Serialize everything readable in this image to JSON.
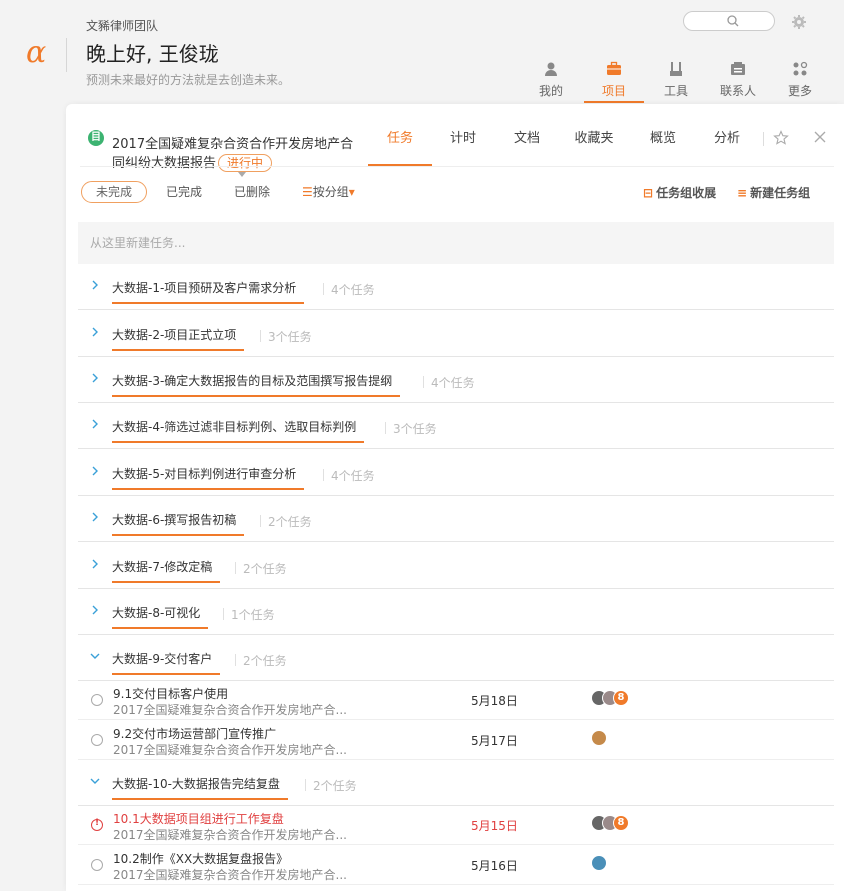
{
  "header": {
    "team": "文豨律师团队",
    "greeting": "晚上好, 王俊珑",
    "motto": "预测未来最好的方法就是去创造未来。"
  },
  "topnav": [
    {
      "label": "我的",
      "icon": "user-icon"
    },
    {
      "label": "项目",
      "icon": "briefcase-icon",
      "active": true
    },
    {
      "label": "工具",
      "icon": "tools-icon"
    },
    {
      "label": "联系人",
      "icon": "contacts-icon"
    },
    {
      "label": "更多",
      "icon": "grid-icon"
    }
  ],
  "project": {
    "icon_letter": "目",
    "title_line1": "2017全国疑难复杂合资合作开发房地产合",
    "title_line2": "同纠纷大数据报告",
    "status": "进行中",
    "tabs": [
      "任务",
      "计时",
      "文档",
      "收藏夹",
      "概览",
      "分析"
    ]
  },
  "filters": {
    "incomplete": "未完成",
    "completed": "已完成",
    "deleted": "已删除",
    "group_by": "按分组",
    "collapse_groups": "任务组收展",
    "new_group": "新建任务组"
  },
  "new_task_placeholder": "从这里新建任务...",
  "groups": [
    {
      "name": "大数据-1-项目预研及客户需求分析",
      "count": "4个任务"
    },
    {
      "name": "大数据-2-项目正式立项",
      "count": "3个任务"
    },
    {
      "name": "大数据-3-确定大数据报告的目标及范围撰写报告提纲",
      "count": "4个任务"
    },
    {
      "name": "大数据-4-筛选过滤非目标判例、选取目标判例",
      "count": "3个任务"
    },
    {
      "name": "大数据-5-对目标判例进行审查分析",
      "count": "4个任务"
    },
    {
      "name": "大数据-6-撰写报告初稿",
      "count": "2个任务"
    },
    {
      "name": "大数据-7-修改定稿",
      "count": "2个任务"
    },
    {
      "name": "大数据-8-可视化",
      "count": "1个任务"
    },
    {
      "name": "大数据-9-交付客户",
      "count": "2个任务"
    },
    {
      "name": "大数据-10-大数据报告完结复盘",
      "count": "2个任务"
    }
  ],
  "tasks": [
    {
      "name": "9.1交付目标客户使用",
      "project": "2017全国疑难复杂合资合作开发房地产合...",
      "date": "5月18日",
      "extra": "8"
    },
    {
      "name": "9.2交付市场运营部门宣传推广",
      "project": "2017全国疑难复杂合资合作开发房地产合...",
      "date": "5月17日"
    },
    {
      "name": "10.1大数据项目组进行工作复盘",
      "project": "2017全国疑难复杂合资合作开发房地产合...",
      "date": "5月15日",
      "extra": "8"
    },
    {
      "name": "10.2制作《XX大数据复盘报告》",
      "project": "2017全国疑难复杂合资合作开发房地产合...",
      "date": "5月16日"
    }
  ],
  "colors": {
    "accent": "#f07a2a",
    "overdue": "#e04040",
    "project_icon": "#3cb371"
  }
}
